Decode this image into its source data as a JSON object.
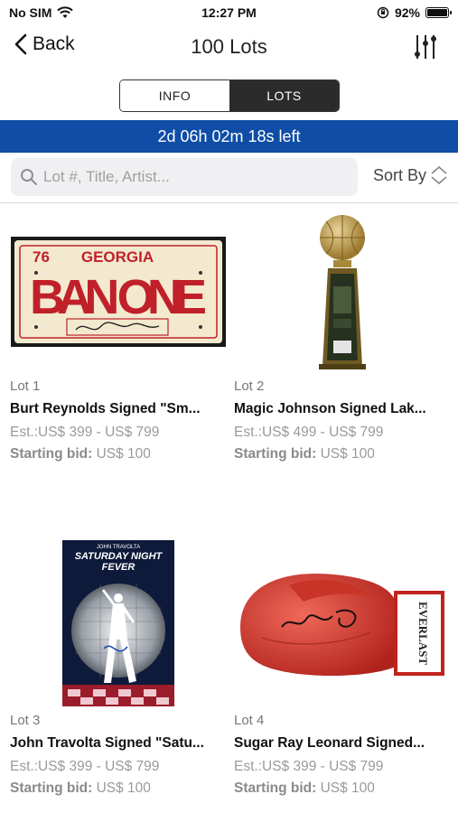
{
  "status_bar": {
    "carrier": "No SIM",
    "time": "12:27 PM",
    "battery_percent": "92%",
    "battery_level": 0.92
  },
  "nav": {
    "back_label": "Back",
    "title": "100 Lots"
  },
  "tabs": [
    {
      "label": "INFO",
      "active": false
    },
    {
      "label": "LOTS",
      "active": true
    }
  ],
  "timer": {
    "text": "2d 06h 02m 18s left"
  },
  "search": {
    "placeholder": "Lot #, Title, Artist..."
  },
  "sort": {
    "label": "Sort By"
  },
  "colors": {
    "timer_bg": "#0f4da6",
    "active_tab": "#2b2b2b"
  },
  "lots": [
    {
      "number": "Lot 1",
      "title": "Burt Reynolds Signed \"Sm...",
      "estimate": "Est.:US$ 399 - US$ 799",
      "starting_bid_label": "Starting bid:",
      "starting_bid_value": "US$ 100",
      "image": "license-plate-image",
      "plate_year": "76",
      "plate_state": "GEORGIA",
      "plate_text": "BAN ONE"
    },
    {
      "number": "Lot 2",
      "title": "Magic Johnson Signed Lak...",
      "estimate": "Est.:US$ 499 - US$ 799",
      "starting_bid_label": "Starting bid:",
      "starting_bid_value": "US$ 100",
      "image": "basketball-trophy-image"
    },
    {
      "number": "Lot 3",
      "title": "John Travolta Signed \"Satu...",
      "estimate": "Est.:US$ 399 - US$ 799",
      "starting_bid_label": "Starting bid:",
      "starting_bid_value": "US$ 100",
      "image": "movie-poster-image",
      "poster_top": "JOHN TRAVOLTA",
      "poster_title_1": "SATURDAY NIGHT",
      "poster_title_2": "FEVER"
    },
    {
      "number": "Lot 4",
      "title": "Sugar Ray Leonard Signed...",
      "estimate": "Est.:US$ 399 - US$ 799",
      "starting_bid_label": "Starting bid:",
      "starting_bid_value": "US$ 100",
      "image": "boxing-glove-image",
      "glove_brand": "EVERLAST"
    }
  ]
}
